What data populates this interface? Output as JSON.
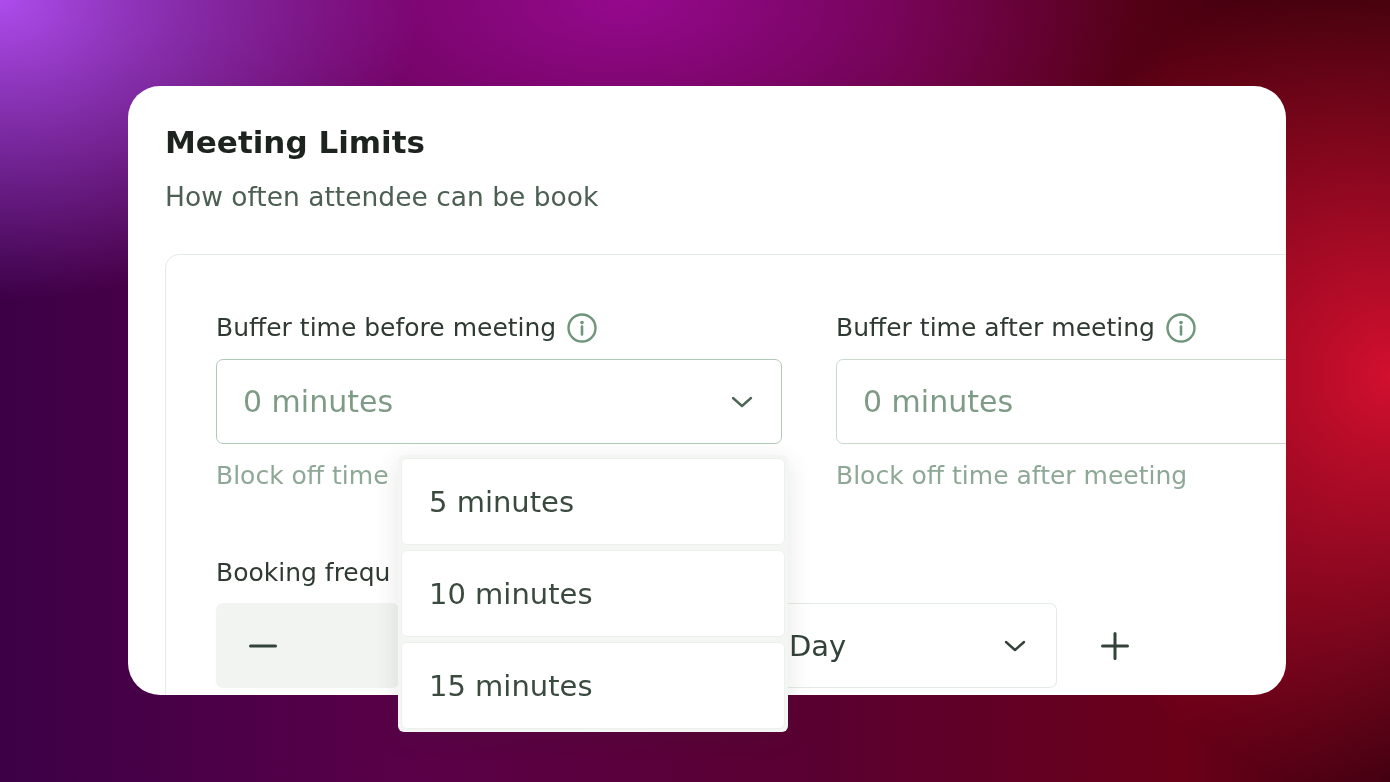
{
  "card": {
    "title": "Meeting Limits",
    "subtitle": "How often attendee can be book",
    "fields": [
      {
        "kind": "select",
        "label": "Buffer time before meeting",
        "placeholder": "0 minutes",
        "helper": "Block off time",
        "expanded": true,
        "options": [
          {
            "label": "5 minutes",
            "selected": false
          },
          {
            "label": "10 minutes",
            "selected": false
          },
          {
            "label": "15 minutes",
            "selected": false
          }
        ]
      },
      {
        "kind": "input",
        "label": "Buffer time after meeting",
        "placeholder": "0 minutes",
        "helper": "Block off time after meeting",
        "expanded": false
      }
    ],
    "booking_frequency": {
      "label": "Booking frequ",
      "unit": "Day"
    }
  }
}
